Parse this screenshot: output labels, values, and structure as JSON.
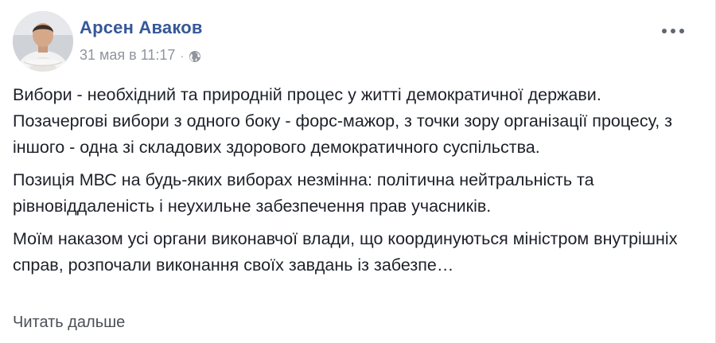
{
  "post": {
    "author": "Арсен Аваков",
    "timestamp": "31 мая в 11:17",
    "separator": "·",
    "privacy_icon": "globe-icon",
    "more_icon": "more-options-icon",
    "paragraphs": [
      "Вибори - необхідний та природній процес у житті демократичної держави. Позачергові вибори з одного боку - форс-мажор, з точки зору організації процесу, з іншого - одна зі складових здорового демократичного суспільства.",
      "Позиція МВС на будь-яких виборах незмінна: політична нейтральність та рівновіддаленість і неухильне забезпечення прав учасників.",
      "Моїм наказом усі органи виконавчої влади, що координуються міністром внутрішніх справ, розпочали виконання своїх завдань із забезпе…"
    ],
    "see_more": "Читать дальше"
  },
  "colors": {
    "author_link": "#365899",
    "meta_text": "#90949c",
    "body_text": "#1d2129",
    "see_more": "#4b4f56"
  }
}
